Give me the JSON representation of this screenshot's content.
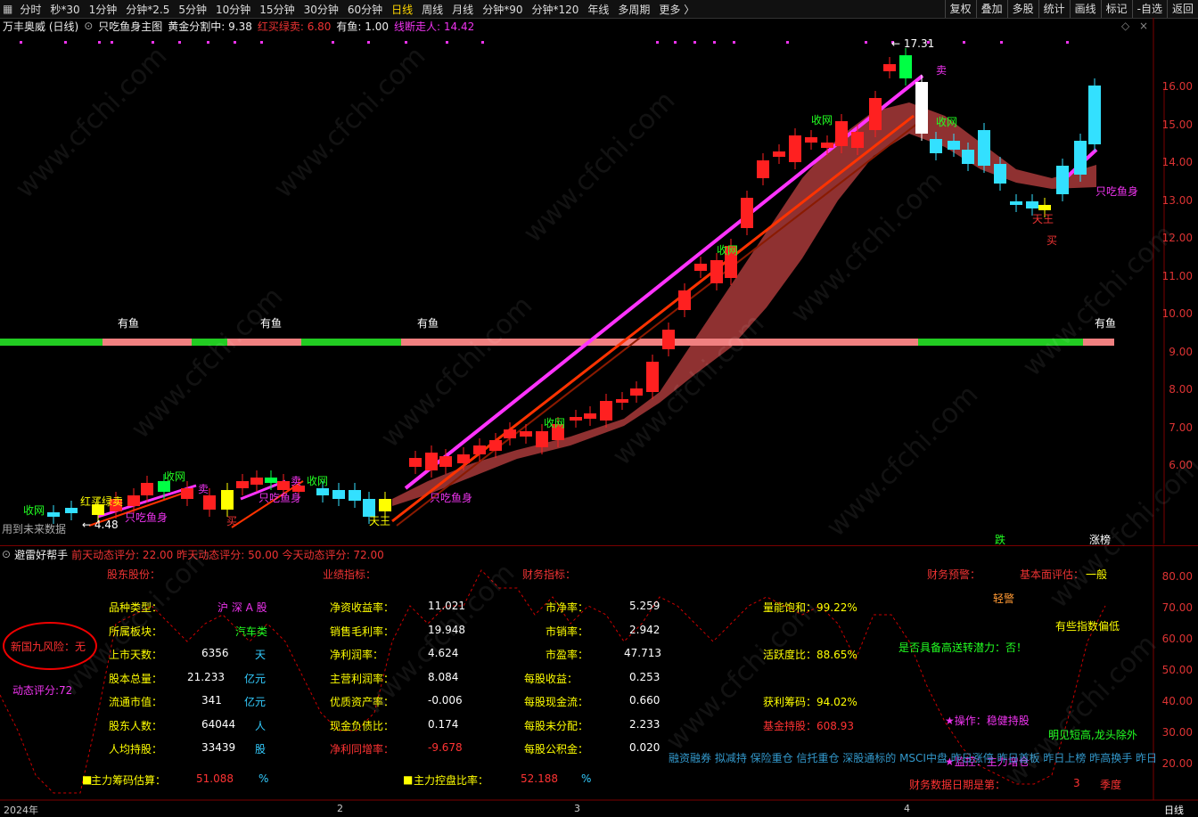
{
  "toolbar": {
    "left_items": [
      "分时",
      "秒*30",
      "1分钟",
      "分钟*2.5",
      "5分钟",
      "10分钟",
      "15分钟",
      "30分钟",
      "60分钟",
      "日线",
      "周线",
      "月线",
      "分钟*90",
      "分钟*120",
      "年线",
      "多周期",
      "更多 〉"
    ],
    "active_item": "日线",
    "right_items": [
      "复权",
      "叠加",
      "多股",
      "统计",
      "画线",
      "标记",
      "-自选",
      "返回"
    ]
  },
  "chart_info": {
    "stock": "万丰奥威 (日线)",
    "indicator": "只吃鱼身主图",
    "golden_label": "黄金分割中: 9.38",
    "red_buy_label": "红买绿卖: 6.80",
    "fish_label": "有鱼: 1.00",
    "line_label": "线断走人: 14.42"
  },
  "price_axis": [
    "16.00",
    "15.00",
    "14.00",
    "13.00",
    "12.00",
    "11.00",
    "10.00",
    "9.00",
    "8.00",
    "7.00",
    "6.00"
  ],
  "price_marks": {
    "high": "17.31",
    "low": "4.48"
  },
  "main_labels": {
    "you_yu": "有鱼",
    "shou_wang": "收网",
    "mai_sell": "卖",
    "mai_buy": "买",
    "only_fish": "只吃鱼身",
    "red_green": "红买绿卖",
    "future_data": "用到未来数据",
    "tian_wang": "天王",
    "die": "跌",
    "zhang_ting": "涨榜"
  },
  "lower_panel": {
    "title": "避雷好帮手",
    "score_prev": "前天动态评分: 22.00",
    "score_yest": "昨天动态评分: 50.00",
    "score_today": "今天动态评分: 72.00",
    "risk_label": "新国九风险：无",
    "dyn_score": "动态评分:72",
    "headers": {
      "holder": "股东股份：",
      "perf": "业绩指标：",
      "fin": "财务指标：",
      "warn": "财务预警：",
      "eval_label": "基本面评估：",
      "eval_val": "一般"
    },
    "col1": [
      {
        "k": "品种类型：",
        "v": "沪 深 A 股",
        "u": ""
      },
      {
        "k": "所属板块：",
        "v": "汽车类",
        "u": ""
      },
      {
        "k": "上市天数：",
        "v": "6356",
        "u": "天"
      },
      {
        "k": "股本总量：",
        "v": "21.233",
        "u": "亿元"
      },
      {
        "k": "流通市值：",
        "v": "341",
        "u": "亿元"
      },
      {
        "k": "股东人数：",
        "v": "64044",
        "u": "人"
      },
      {
        "k": "人均持股：",
        "v": "33439",
        "u": "股"
      }
    ],
    "col2": [
      {
        "k": "净资收益率：",
        "v": "11.021"
      },
      {
        "k": "销售毛利率：",
        "v": "19.948"
      },
      {
        "k": "净利润率：",
        "v": "4.624"
      },
      {
        "k": "主营利润率：",
        "v": "8.084"
      },
      {
        "k": "优质资产率：",
        "v": "-0.006"
      },
      {
        "k": "现金负债比：",
        "v": "0.174"
      },
      {
        "k": "净利同增率：",
        "v": "-9.678"
      }
    ],
    "col3": [
      {
        "k": "市净率：",
        "v": "5.259"
      },
      {
        "k": "市销率：",
        "v": "2.942"
      },
      {
        "k": "市盈率：",
        "v": "47.713"
      },
      {
        "k": "每股收益：",
        "v": "0.253"
      },
      {
        "k": "每股现金流：",
        "v": "0.660"
      },
      {
        "k": "每股未分配：",
        "v": "2.233"
      },
      {
        "k": "每股公积金：",
        "v": "0.020"
      }
    ],
    "col4": {
      "energy": "量能饱和：99.22%",
      "activity": "活跃度比：88.65%",
      "profit_chip": "获利筹码：94.02%",
      "fund_hold": "基金持股：608.93",
      "light_warn": "轻警",
      "index_low": "有些指数偏低",
      "high_send": "是否具备高送转潜力：否！",
      "operate": "★操作：稳健持股",
      "monitor": "★监控：主力增仓",
      "trend": "明见短高,龙头除外",
      "tags": "融资融券 拟减持 保险重仓 信托重仓 深股通标的 MSCI中盘 昨日涨停 昨日首板 昨日上榜 昨高换手 昨日",
      "report_date": "财务数据日期是第：",
      "report_q": "3",
      "report_unit": "季度"
    },
    "chip_est_label": "主力筹码估算：",
    "chip_est_val": "51.088",
    "chip_pct": "%",
    "ctrl_label": "主力控盘比率：",
    "ctrl_val": "52.188",
    "ctrl_pct": "%",
    "axis": [
      "80.00",
      "70.00",
      "60.00",
      "50.00",
      "40.00",
      "30.00",
      "20.00"
    ]
  },
  "x_axis": [
    "2024年",
    "2",
    "3",
    "4"
  ],
  "x_right": "日线",
  "watermark": "www.cfchi.com"
}
